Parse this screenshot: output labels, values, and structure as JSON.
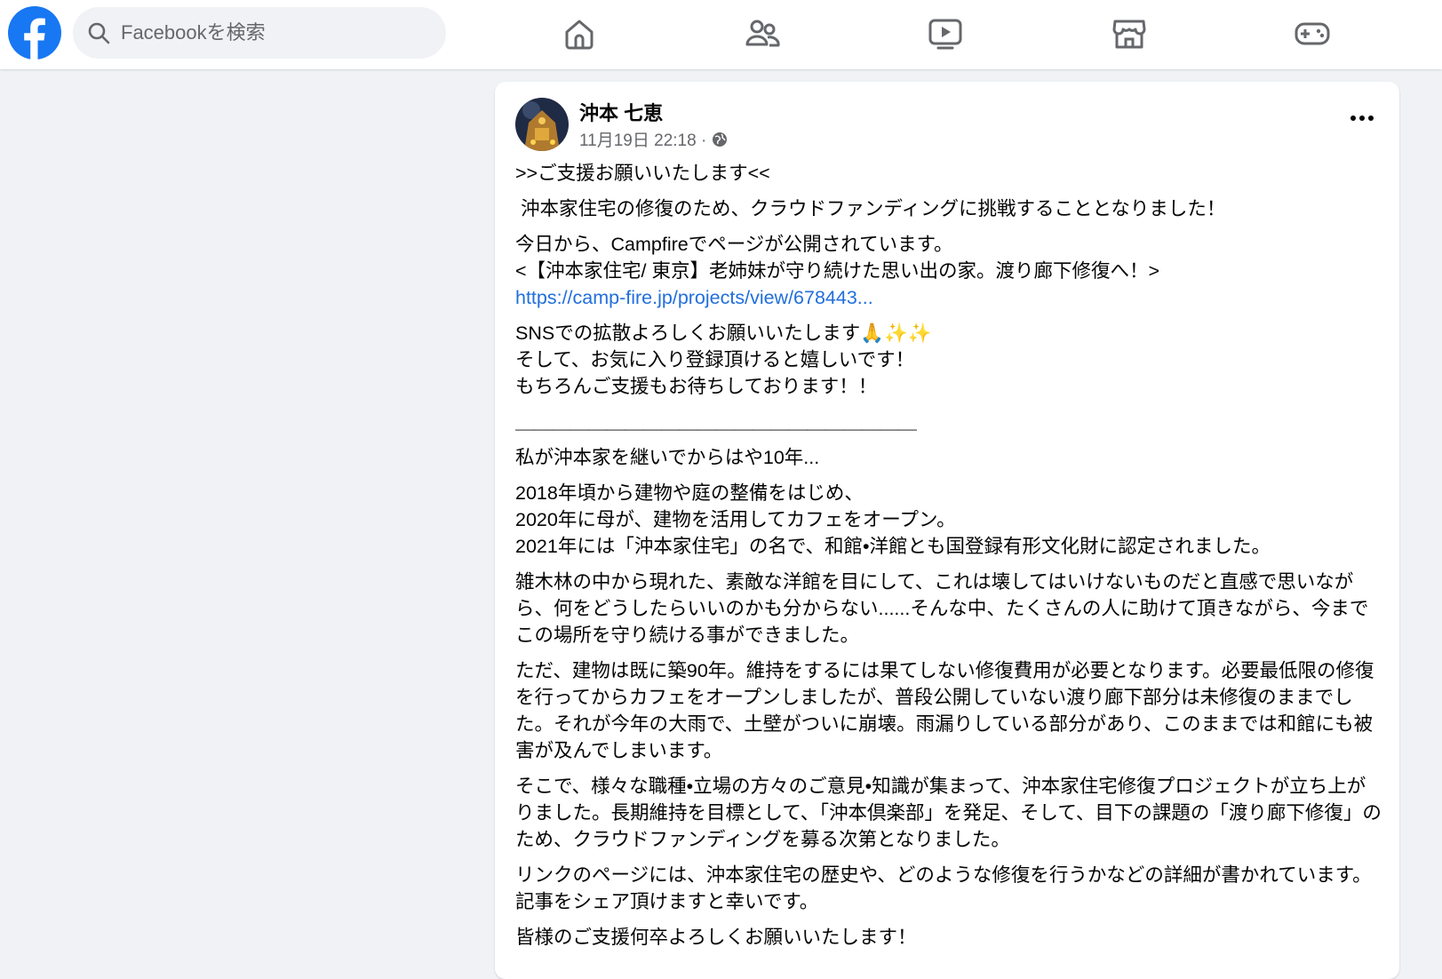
{
  "search": {
    "placeholder": "Facebookを検索"
  },
  "nav": [
    "home-icon",
    "friends-icon",
    "watch-icon",
    "marketplace-icon",
    "gaming-icon"
  ],
  "colors": {
    "brand": "#1877f2",
    "link": "#216fdb",
    "background": "#f0f2f5"
  },
  "post": {
    "author": "沖本 七恵",
    "timestamp": "11月19日 22:18 ·",
    "paragraphs": [
      ">>ご支援お願いいたします<<",
      " 沖本家住宅の修復のため、クラウドファンディングに挑戦することとなりました！",
      "今日から、Campfireでページが公開されています。\n<【沖本家住宅/ 東京】老姉妹が守り続けた思い出の家。渡り廊下修復へ！>"
    ],
    "link": "https://camp-fire.jp/projects/view/678443...",
    "sns_text": "SNSでの拡散よろしくお願いいたします🙏✨✨\nそして、お気に入り登録頂けると嬉しいです！\nもちろんご支援もお待ちしております！！",
    "divider": "＿＿＿＿＿＿＿＿＿＿＿＿＿＿＿＿＿＿＿＿＿＿",
    "story": [
      "私が沖本家を継いでからはや10年...",
      "2018年頃から建物や庭の整備をはじめ、\n2020年に母が、建物を活用してカフェをオープン。\n2021年には「沖本家住宅」の名で、和館•洋館とも国登録有形文化財に認定されました。",
      "雑木林の中から現れた、素敵な洋館を目にして、これは壊してはいけないものだと直感で思いながら、何をどうしたらいいのかも分からない......そんな中、たくさんの人に助けて頂きながら、今までこの場所を守り続ける事ができました。",
      "ただ、建物は既に築90年。維持をするには果てしない修復費用が必要となります。必要最低限の修復を行ってからカフェをオープンしましたが、普段公開していない渡り廊下部分は未修復のままでした。それが今年の大雨で、土壁がついに崩壊。雨漏りしている部分があり、このままでは和館にも被害が及んでしまいます。",
      "そこで、様々な職種•立場の方々のご意見•知識が集まって、沖本家住宅修復プロジェクトが立ち上がりました。長期維持を目標として、「沖本倶楽部」を発足、そして、目下の課題の「渡り廊下修復」のため、クラウドファンディングを募る次第となりました。",
      "リンクのページには、沖本家住宅の歴史や、どのような修復を行うかなどの詳細が書かれています。記事をシェア頂けますと幸いです。",
      "皆様のご支援何卒よろしくお願いいたします！"
    ]
  }
}
